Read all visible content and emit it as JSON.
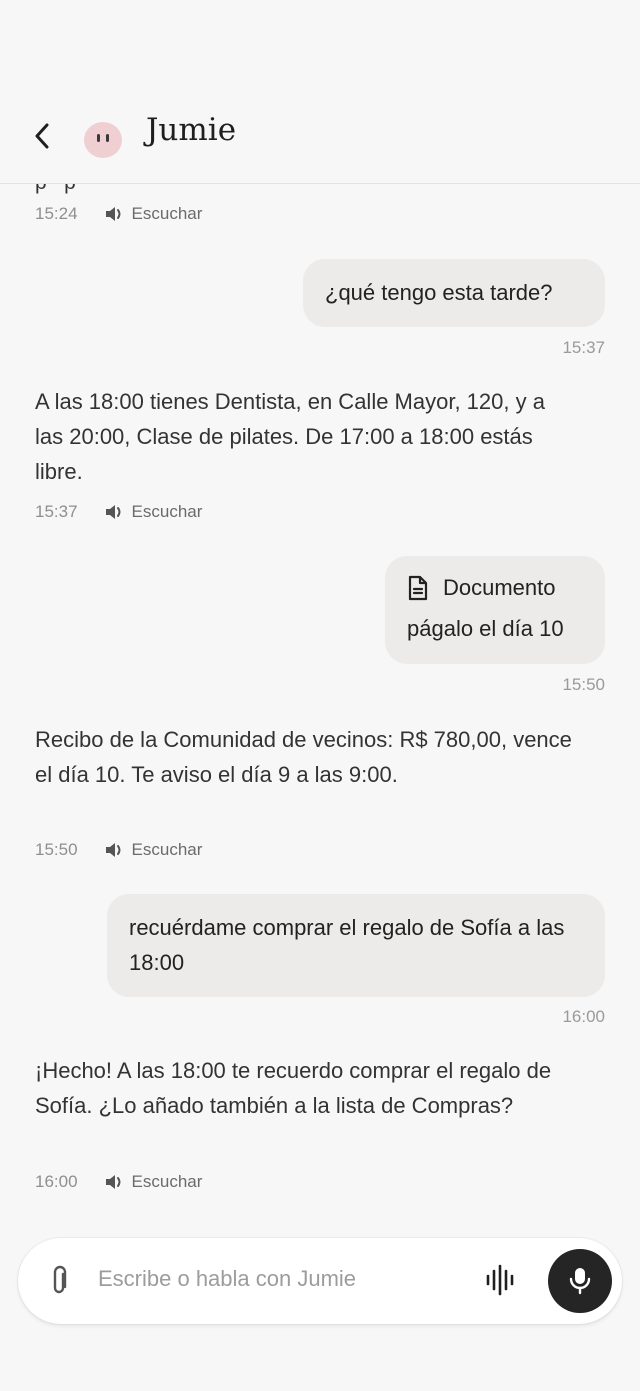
{
  "header": {
    "title": "Jumie",
    "back_icon": "chevron-left-icon",
    "avatar_icon": "jumie-avatar"
  },
  "messages": [
    {
      "role": "bot",
      "text": "",
      "time": "15:24",
      "listen_label": "Escuchar"
    },
    {
      "role": "user",
      "text": "¿qué tengo esta tarde?",
      "time": "15:37"
    },
    {
      "role": "bot",
      "text": "A las 18:00 tienes Dentista, en Calle Mayor, 120, y a las 20:00, Clase de pilates. De 17:00 a 18:00 estás libre.",
      "time": "15:37",
      "listen_label": "Escuchar"
    },
    {
      "role": "user",
      "attachment_label": "Documento",
      "attachment_icon": "document-icon",
      "text": "págalo el día 10",
      "time": "15:50"
    },
    {
      "role": "bot",
      "text": "Recibo de la Comunidad de vecinos: R$ 780,00, vence el día 10. Te aviso el día 9 a las 9:00.",
      "time": "15:50",
      "listen_label": "Escuchar"
    },
    {
      "role": "user",
      "text": "recuérdame comprar el regalo de Sofía a las 18:00",
      "time": "16:00"
    },
    {
      "role": "bot",
      "text": "¡Hecho! A las 18:00 te recuerdo comprar el regalo de Sofía. ¿Lo añado también a la lista de Compras?",
      "time": "16:00",
      "listen_label": "Escuchar"
    }
  ],
  "composer": {
    "placeholder": "Escribe o habla con Jumie",
    "attach_icon": "paperclip-icon",
    "voice_wave_icon": "waveform-icon",
    "mic_icon": "microphone-icon"
  },
  "colors": {
    "background": "#f7f7f7",
    "user_bubble": "#ecebea",
    "mic_button": "#262525",
    "avatar": "#f0cfd2"
  }
}
